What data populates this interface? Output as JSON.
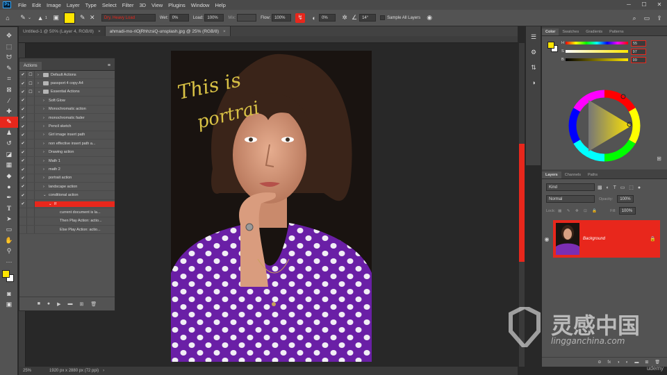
{
  "menubar": {
    "logo": "Ps",
    "items": [
      "File",
      "Edit",
      "Image",
      "Layer",
      "Type",
      "Select",
      "Filter",
      "3D",
      "View",
      "Plugins",
      "Window",
      "Help"
    ]
  },
  "options": {
    "brush_size": "1",
    "preset": "Dry, Heavy Load",
    "wet_label": "Wet:",
    "wet": "0%",
    "load_label": "Load:",
    "load": "100%",
    "mix_label": "Mix:",
    "flow_label": "Flow:",
    "flow": "100%",
    "smoothing": "0%",
    "angle": "14°",
    "sample_all_label": "Sample All Layers",
    "accent": "#e8271c",
    "swatch_color": "#ffe500"
  },
  "doc_tabs": [
    {
      "label": "Untitled-1 @ 50% (Layer 4, RGB/8)",
      "close": "×"
    },
    {
      "label": "ahmadi-mo-riOjRhhzsiQ-unsplash.jpg @ 25% (RGB/8)",
      "close": "×"
    }
  ],
  "actions_panel": {
    "title": "Actions",
    "rows": [
      {
        "c1": "✔",
        "c2": "☐",
        "indent": 0,
        "arrow": "›",
        "folder": true,
        "label": "Default Actions",
        "sel": false
      },
      {
        "c1": "✔",
        "c2": "☐",
        "indent": 0,
        "arrow": "›",
        "folder": true,
        "label": "passport 4 copy A4",
        "sel": false
      },
      {
        "c1": "✔",
        "c2": "☐",
        "indent": 0,
        "arrow": "⌄",
        "folder": true,
        "label": "Essential Actions",
        "sel": false
      },
      {
        "c1": "✔",
        "c2": "",
        "indent": 1,
        "arrow": "›",
        "folder": false,
        "label": "Soft Glow",
        "sel": false
      },
      {
        "c1": "✔",
        "c2": "",
        "indent": 1,
        "arrow": "›",
        "folder": false,
        "label": "Monochromatic action",
        "sel": false
      },
      {
        "c1": "✔",
        "c2": "",
        "indent": 1,
        "arrow": "›",
        "folder": false,
        "label": "monochromatic fader",
        "sel": false
      },
      {
        "c1": "✔",
        "c2": "",
        "indent": 1,
        "arrow": "›",
        "folder": false,
        "label": "Pencil sketch",
        "sel": false
      },
      {
        "c1": "✔",
        "c2": "",
        "indent": 1,
        "arrow": "›",
        "folder": false,
        "label": "Girl image insert path",
        "sel": false
      },
      {
        "c1": "✔",
        "c2": "",
        "indent": 1,
        "arrow": "›",
        "folder": false,
        "label": "non effective insert path a...",
        "sel": false
      },
      {
        "c1": "✔",
        "c2": "",
        "indent": 1,
        "arrow": "›",
        "folder": false,
        "label": "Drawing action",
        "sel": false
      },
      {
        "c1": "✔",
        "c2": "",
        "indent": 1,
        "arrow": "›",
        "folder": false,
        "label": "Math 1",
        "sel": false
      },
      {
        "c1": "✔",
        "c2": "",
        "indent": 1,
        "arrow": "›",
        "folder": false,
        "label": "math 2",
        "sel": false
      },
      {
        "c1": "✔",
        "c2": "",
        "indent": 1,
        "arrow": "›",
        "folder": false,
        "label": "portrait action",
        "sel": false
      },
      {
        "c1": "✔",
        "c2": "",
        "indent": 1,
        "arrow": "›",
        "folder": false,
        "label": "landscape action",
        "sel": false
      },
      {
        "c1": "✔",
        "c2": "",
        "indent": 1,
        "arrow": "⌄",
        "folder": false,
        "label": "conditional action",
        "sel": false
      },
      {
        "c1": "✔",
        "c2": "",
        "indent": 2,
        "arrow": "⌄",
        "folder": false,
        "label": "If",
        "sel": true
      },
      {
        "c1": "",
        "c2": "",
        "indent": 3,
        "arrow": "",
        "folder": false,
        "label": "current document is la...",
        "sel": false
      },
      {
        "c1": "",
        "c2": "",
        "indent": 3,
        "arrow": "",
        "folder": false,
        "label": "Then Play Action: actio...",
        "sel": false
      },
      {
        "c1": "",
        "c2": "",
        "indent": 3,
        "arrow": "",
        "folder": false,
        "label": "Else Play Action: actio...",
        "sel": false
      }
    ],
    "footer_icons": [
      "■",
      "●",
      "▶",
      "▬",
      "⊞",
      "🗑"
    ]
  },
  "canvas": {
    "handwriting_line1": "This is",
    "handwriting_line2": "portrai"
  },
  "status": {
    "zoom": "25%",
    "doc_info": "1920 px x 2880 px (72 ppi)",
    "arrow": "›"
  },
  "color_panel": {
    "tabs": [
      "Color",
      "Swatches",
      "Gradients",
      "Patterns"
    ],
    "channels": [
      {
        "label": "H",
        "value": "55"
      },
      {
        "label": "S",
        "value": "97"
      },
      {
        "label": "B",
        "value": "99"
      }
    ]
  },
  "layers_panel": {
    "tabs": [
      "Layers",
      "Channels",
      "Paths"
    ],
    "kind_label": "Kind",
    "blend_mode": "Normal",
    "opacity_label": "Opacity:",
    "opacity": "100%",
    "lock_label": "Lock:",
    "fill_label": "Fill:",
    "fill": "100%",
    "layer_name": "Background",
    "footer_icons": [
      "⊖",
      "fx",
      "◑",
      "◐",
      "▬",
      "⊞",
      "🗑"
    ]
  },
  "watermark": {
    "brand": "灵感中国",
    "domain": "lingganchina.com",
    "udemy": "udemy"
  }
}
